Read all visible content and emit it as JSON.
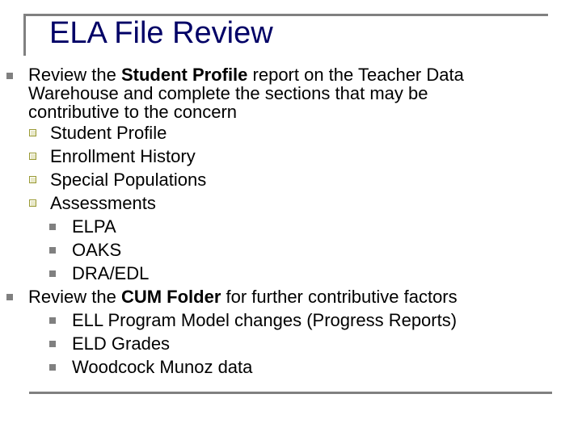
{
  "slide": {
    "title": "ELA File Review",
    "items": [
      {
        "level": 1,
        "lines": [
          {
            "pre": "Review the ",
            "bold": "Student Profile",
            "post": " report on the Teacher Data"
          },
          {
            "text": "Warehouse and complete the sections that may be"
          },
          {
            "text": "contributive to the concern"
          }
        ]
      },
      {
        "level": 2,
        "text": "Student Profile"
      },
      {
        "level": 2,
        "text": "Enrollment History"
      },
      {
        "level": 2,
        "text": "Special Populations"
      },
      {
        "level": 2,
        "text": "Assessments"
      },
      {
        "level": 3,
        "text": "ELPA"
      },
      {
        "level": 3,
        "text": "OAKS"
      },
      {
        "level": 3,
        "text": "DRA/EDL"
      },
      {
        "level": 1,
        "lines": [
          {
            "pre": "Review the ",
            "bold": "CUM Folder",
            "post": " for further contributive factors"
          }
        ]
      },
      {
        "level": 3,
        "text": "ELL Program Model changes (Progress Reports)"
      },
      {
        "level": 3,
        "text": "ELD Grades"
      },
      {
        "level": 3,
        "text": "Woodcock Munoz data"
      }
    ]
  },
  "colors": {
    "title": "#000066",
    "frame": "#808080",
    "bullet_square": "#808080",
    "bullet_box": "#999933"
  }
}
